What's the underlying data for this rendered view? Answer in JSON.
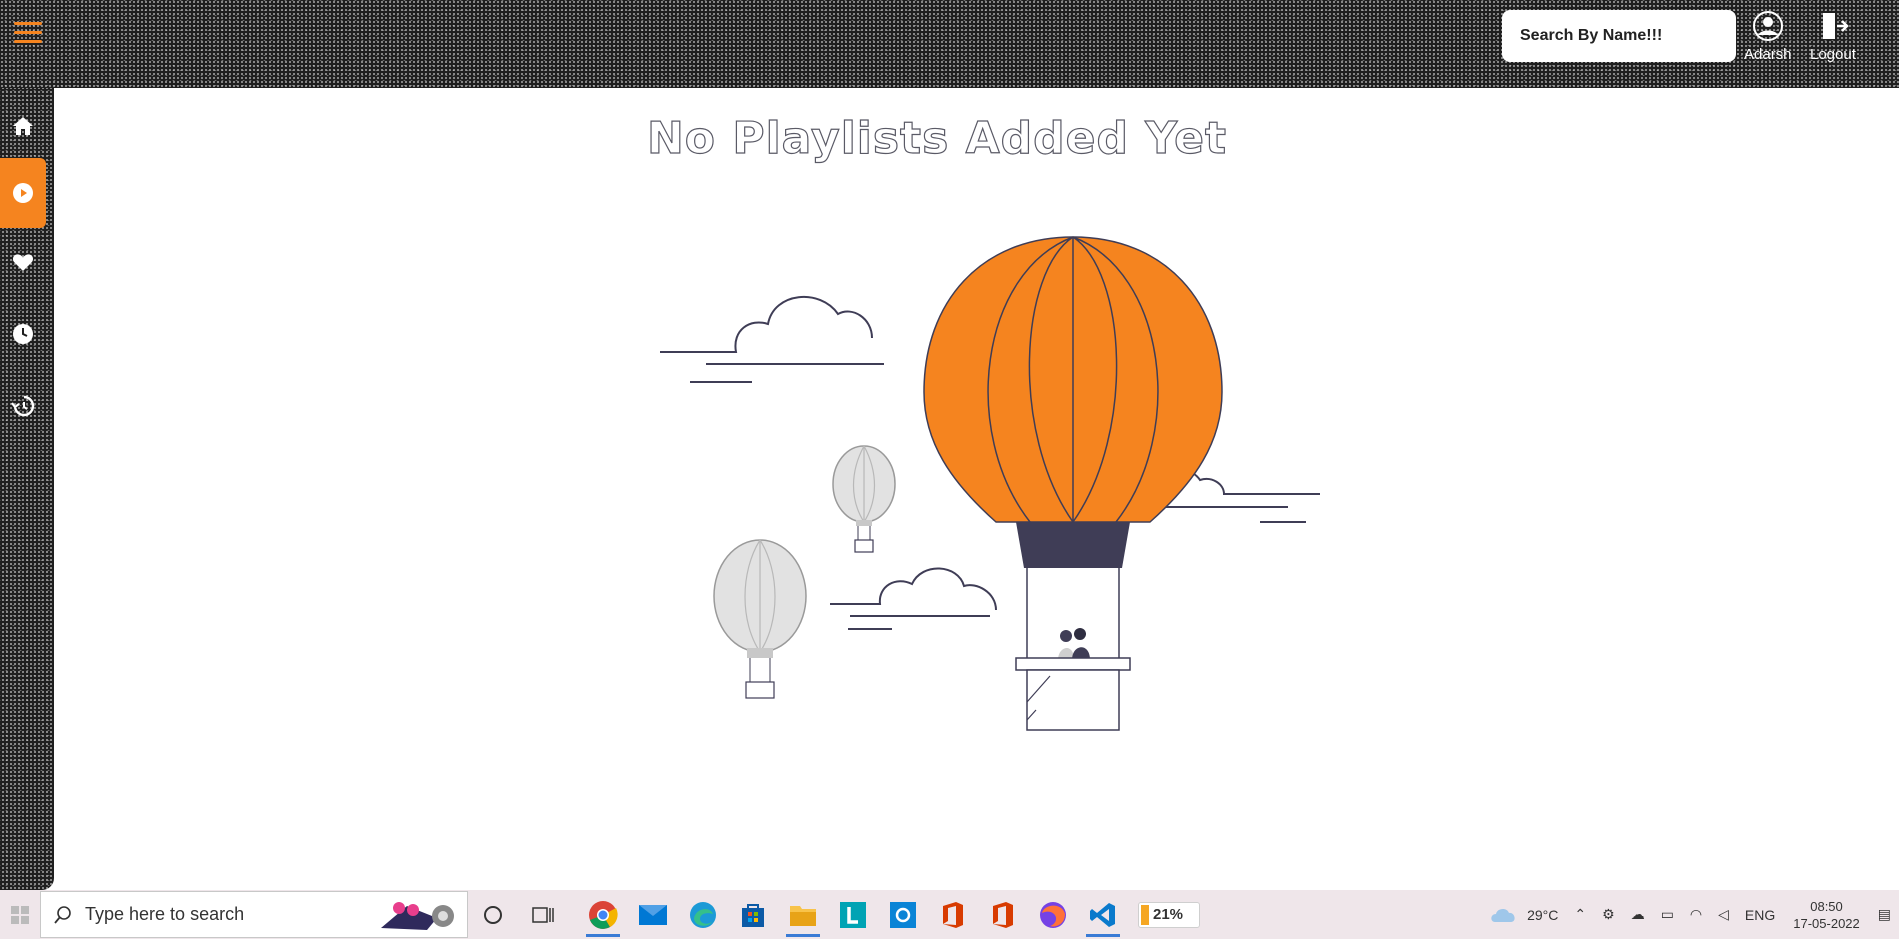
{
  "header": {
    "search_placeholder": "Search By Name!!!",
    "user_label": "Adarsh",
    "logout_label": "Logout"
  },
  "sidebar": {
    "items": [
      {
        "name": "home",
        "icon": "home-icon"
      },
      {
        "name": "playlists",
        "icon": "play-circle-icon",
        "active": true
      },
      {
        "name": "liked",
        "icon": "heart-icon"
      },
      {
        "name": "watch-later",
        "icon": "clock-icon"
      },
      {
        "name": "history",
        "icon": "history-icon"
      }
    ]
  },
  "main": {
    "empty_message": "No Playlists Added Yet",
    "illustration": "hot-air-balloon-illustration"
  },
  "taskbar": {
    "search_placeholder": "Type here to search",
    "battery_percent": "21%",
    "weather": "29°C",
    "language": "ENG",
    "time": "08:50",
    "date": "17-05-2022"
  },
  "colors": {
    "accent": "#f5841f",
    "dark": "#1f1f1f",
    "illustration_outline": "#3f3d56"
  }
}
